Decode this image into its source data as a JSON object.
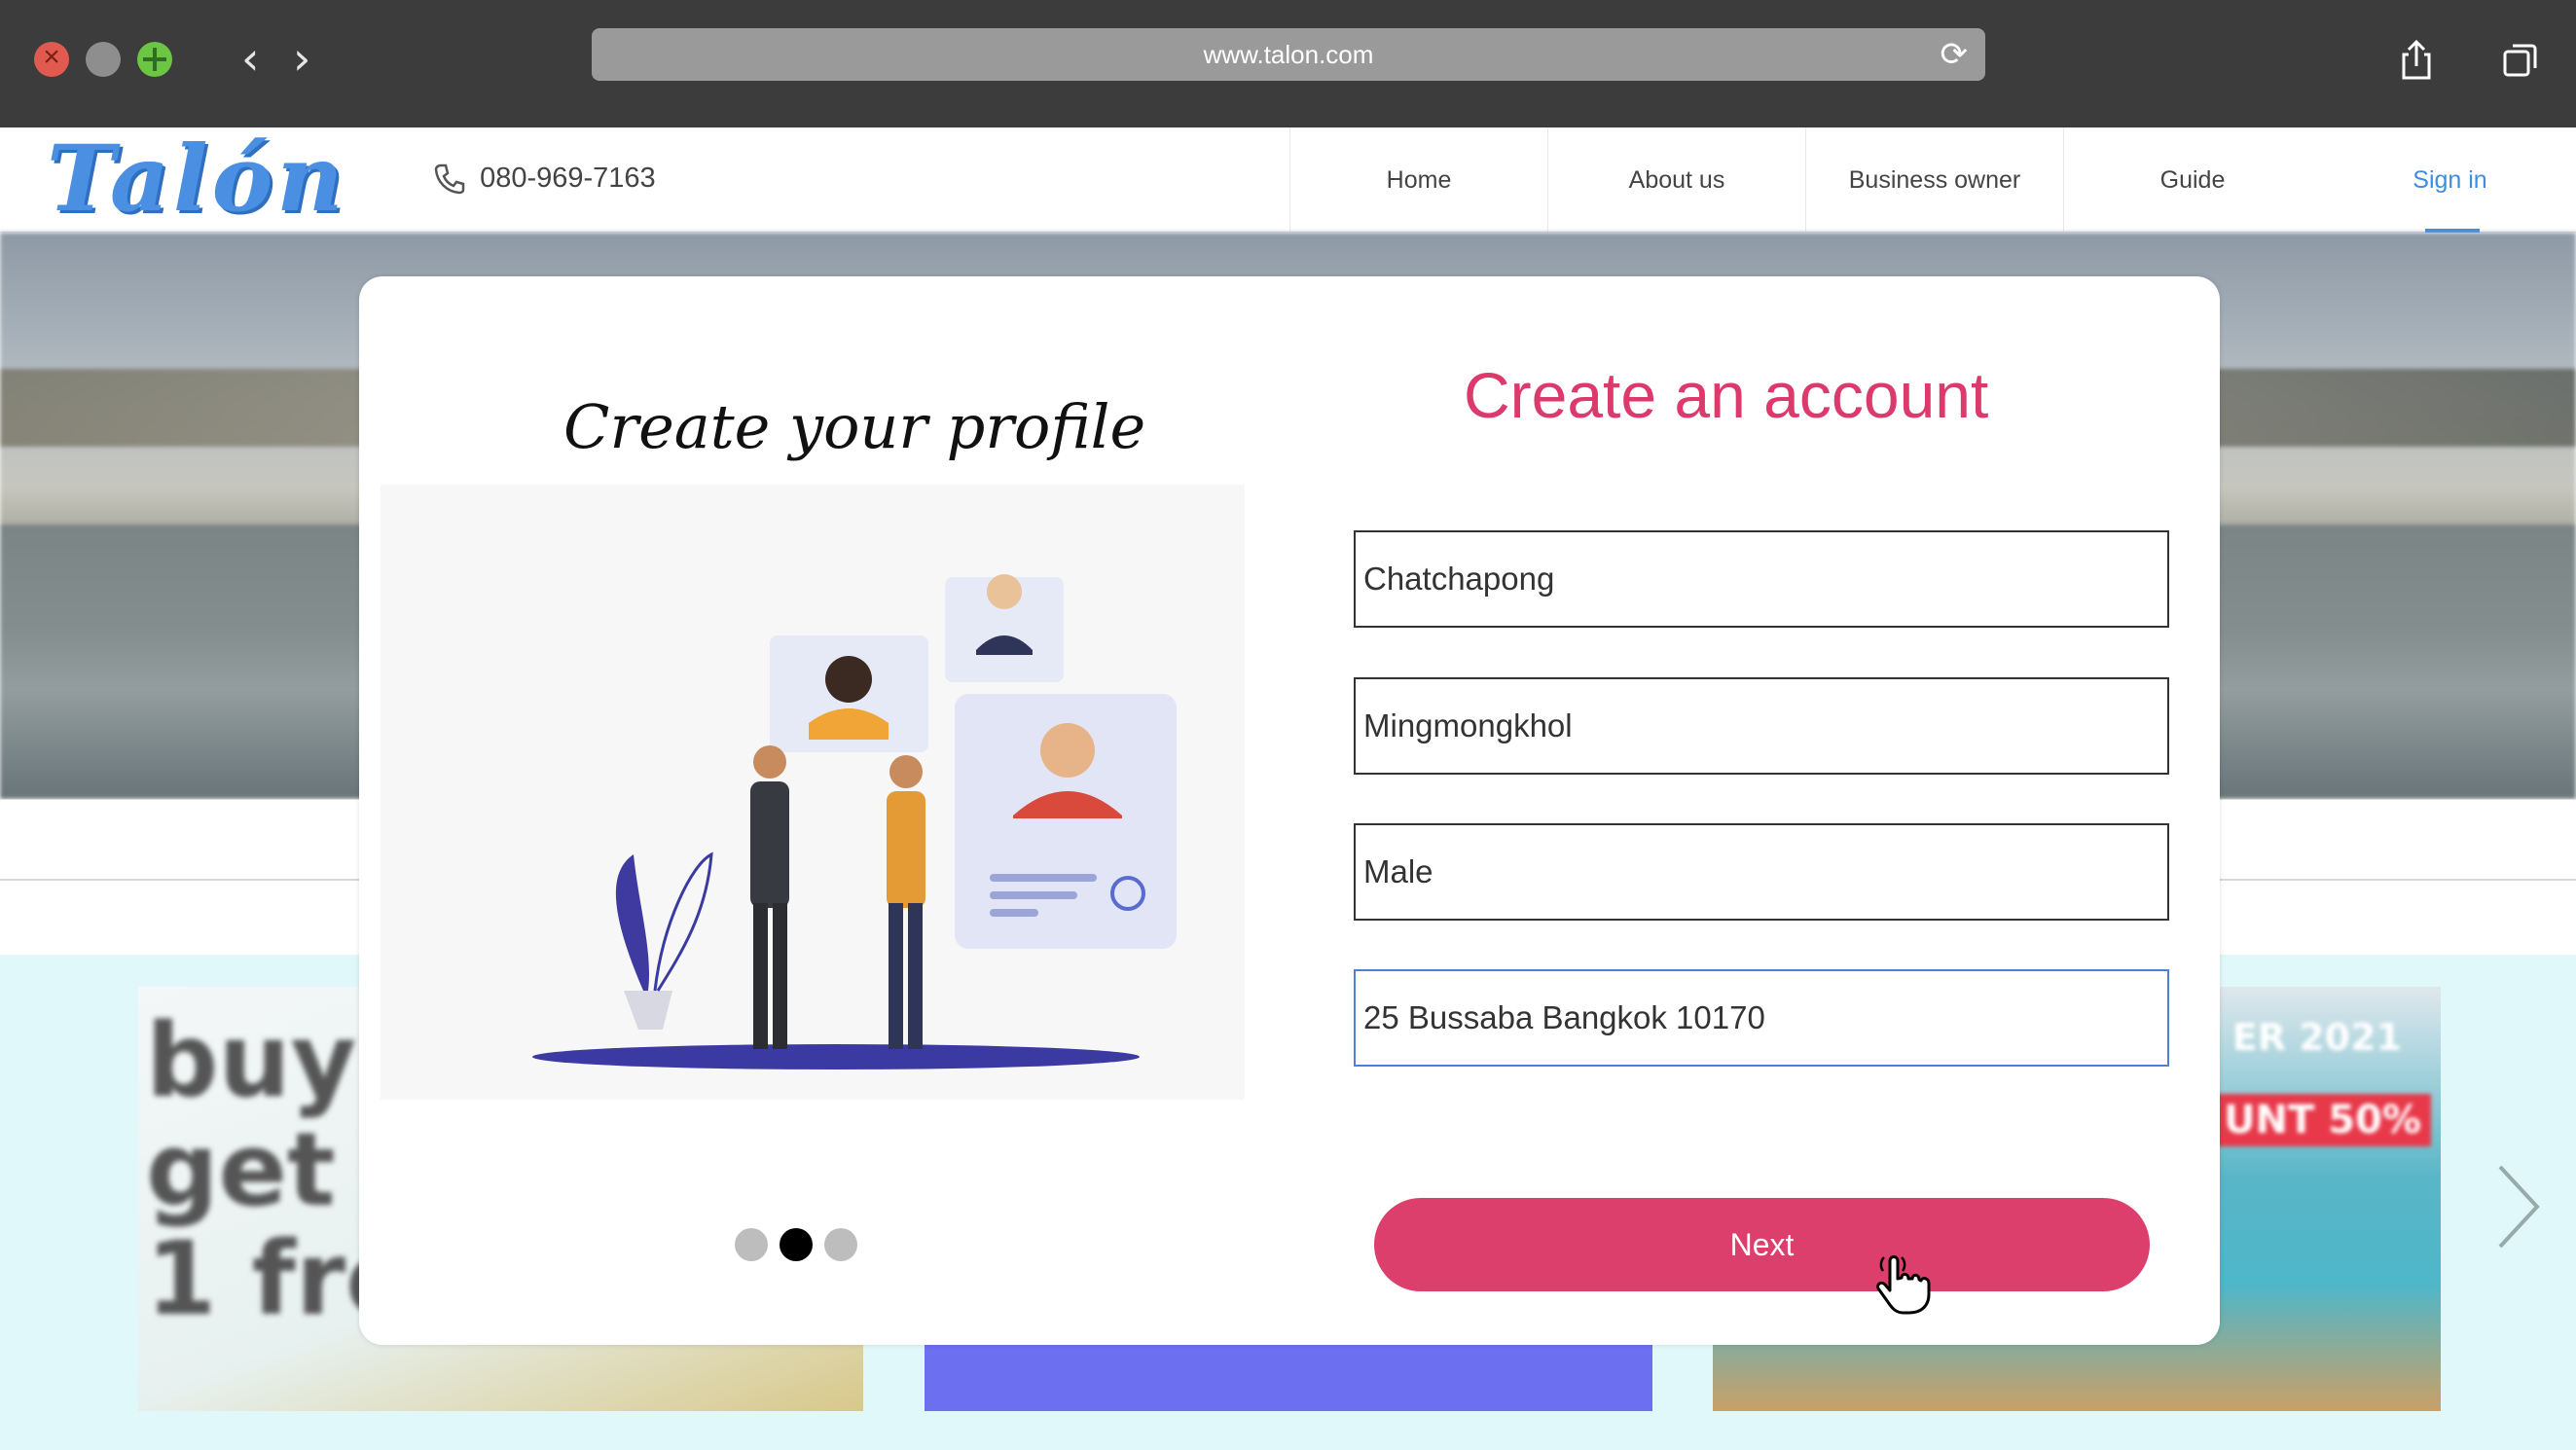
{
  "browser": {
    "url": "www.talon.com",
    "icons": [
      "close-icon",
      "minimize-icon",
      "maximize-icon",
      "back-arrow-icon",
      "forward-arrow-icon",
      "reload-icon",
      "share-icon",
      "tabs-icon"
    ],
    "back_glyph": "‹",
    "forward_glyph": "›",
    "reload_glyph": "⟳"
  },
  "header": {
    "logo": "Talón",
    "phone": "080-969-7163",
    "nav": [
      {
        "label": "Home",
        "active": false
      },
      {
        "label": "About us",
        "active": false
      },
      {
        "label": "Business owner",
        "active": false
      },
      {
        "label": "Guide",
        "active": false
      },
      {
        "label": "Sign in",
        "active": true
      }
    ],
    "accent_color": "#3d8ee0"
  },
  "background": {
    "promo_1_text": "buy 1\nget\n1 free",
    "promo_3_top": "ER 2021",
    "promo_3_banner": "UNT 50%"
  },
  "modal": {
    "left_title": "Create your profile",
    "slide_index": 2,
    "slide_count": 3,
    "title": "Create an account",
    "fields": [
      {
        "value": "Chatchapong"
      },
      {
        "value": "Mingmongkhol"
      },
      {
        "value": "Male"
      },
      {
        "value": "25 Bussaba Bangkok 10170",
        "focused": true
      }
    ],
    "next_label": "Next",
    "brand_color": "#dc3f6c"
  }
}
